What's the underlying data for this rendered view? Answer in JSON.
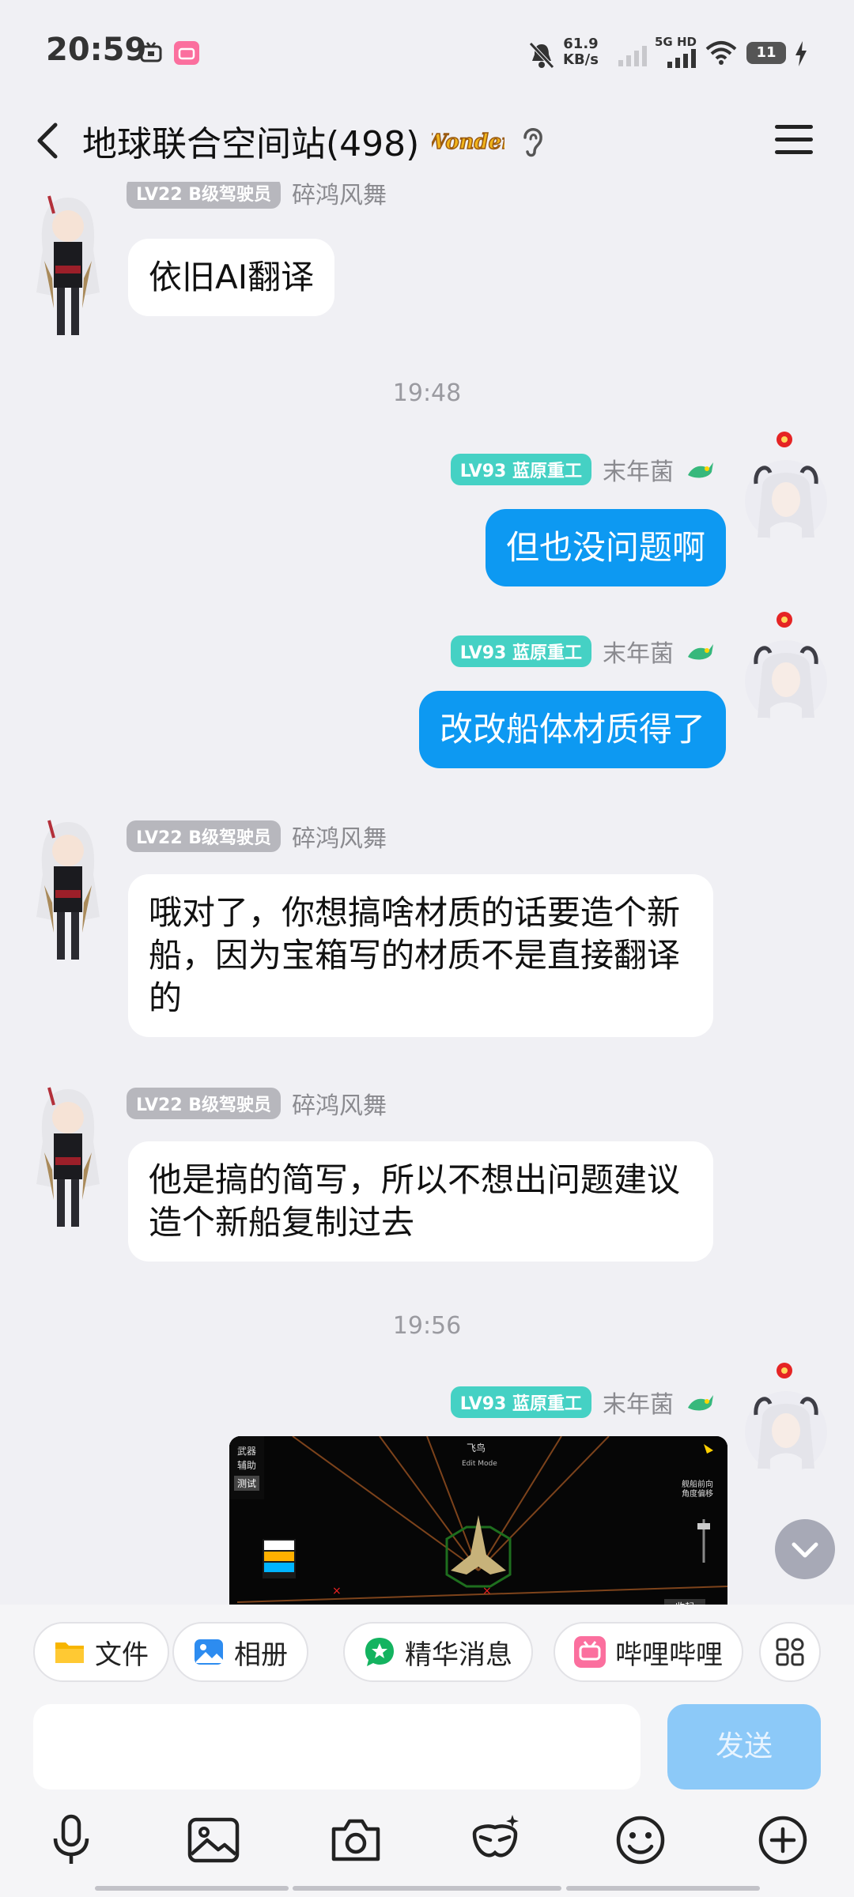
{
  "status_bar": {
    "time": "20:59",
    "net_speed_value": "61.9",
    "net_speed_unit": "KB/s",
    "network": "5G HD",
    "battery": "11"
  },
  "header": {
    "title": "地球联合空间站(498)",
    "badge_text": "Wonder"
  },
  "messages": [
    {
      "side": "left",
      "level_tag": "LV22 B级驾驶员",
      "nickname": "碎鸿风舞",
      "text": "依旧AI翻译"
    },
    {
      "type": "time",
      "text": "19:48"
    },
    {
      "side": "right",
      "level_tag": "LV93 蓝原重工",
      "nickname": "末年菌",
      "text": "但也没问题啊"
    },
    {
      "side": "right",
      "level_tag": "LV93 蓝原重工",
      "nickname": "末年菌",
      "text": "改改船体材质得了"
    },
    {
      "side": "left",
      "level_tag": "LV22 B级驾驶员",
      "nickname": "碎鸿风舞",
      "text": "哦对了，你想搞啥材质的话要造个新船，因为宝箱写的材质不是直接翻译的"
    },
    {
      "side": "left",
      "level_tag": "LV22 B级驾驶员",
      "nickname": "碎鸿风舞",
      "text": "他是搞的简写，所以不想出问题建议造个新船复制过去"
    },
    {
      "type": "time",
      "text": "19:56"
    },
    {
      "side": "right",
      "level_tag": "LV93 蓝原重工",
      "nickname": "末年菌",
      "type_image": true
    }
  ],
  "screenshot_ui": {
    "weapon": "武器",
    "assist": "辅助",
    "test": "测试",
    "title": "飞鸟",
    "mode": "Edit Mode",
    "right_label": "舰船前向角度偏移",
    "collapse": "收起"
  },
  "shortcuts": [
    {
      "label": "文件"
    },
    {
      "label": "相册"
    },
    {
      "label": "精华消息"
    },
    {
      "label": "哔哩哔哩"
    }
  ],
  "input": {
    "send_label": "发送"
  }
}
